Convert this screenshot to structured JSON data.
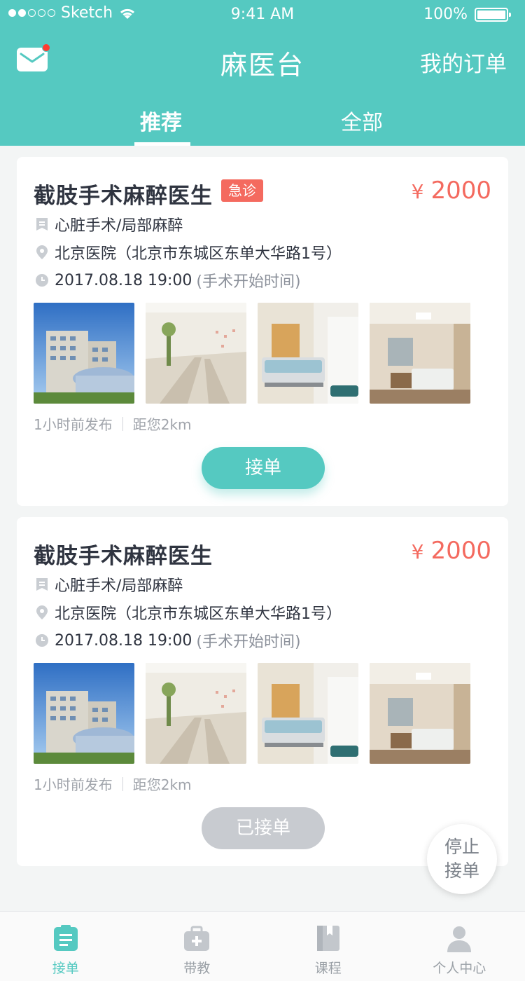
{
  "status_bar": {
    "carrier": "Sketch",
    "time": "9:41 AM",
    "battery": "100%"
  },
  "header": {
    "title": "麻医台",
    "orders_link": "我的订单",
    "tabs": [
      {
        "label": "推荐",
        "active": true
      },
      {
        "label": "全部",
        "active": false
      }
    ]
  },
  "cards": [
    {
      "title": "截肢手术麻醉医生",
      "badge": "急诊",
      "price_symbol": "¥",
      "price": "2000",
      "category": "心脏手术/局部麻醉",
      "location": "北京医院（北京市东城区东单大华路1号）",
      "time": "2017.08.18 19:00",
      "time_note": "(手术开始时间)",
      "posted": "1小时前发布",
      "distance": "距您2km",
      "action": "接单"
    },
    {
      "title": "截肢手术麻醉医生",
      "price_symbol": "¥",
      "price": "2000",
      "category": "心脏手术/局部麻醉",
      "location": "北京医院（北京市东城区东单大华路1号）",
      "time": "2017.08.18 19:00",
      "time_note": "(手术开始时间)",
      "posted": "1小时前发布",
      "distance": "距您2km",
      "action": "已接单"
    }
  ],
  "floating_button": {
    "line1": "停止",
    "line2": "接单"
  },
  "bottom_nav": [
    {
      "label": "接单",
      "icon": "clipboard-icon",
      "active": true
    },
    {
      "label": "带教",
      "icon": "medical-kit-icon",
      "active": false
    },
    {
      "label": "课程",
      "icon": "book-icon",
      "active": false
    },
    {
      "label": "个人中心",
      "icon": "user-icon",
      "active": false
    }
  ],
  "colors": {
    "primary": "#55c9c1",
    "accent": "#f46a5f",
    "inactive": "#c8cbd0"
  }
}
